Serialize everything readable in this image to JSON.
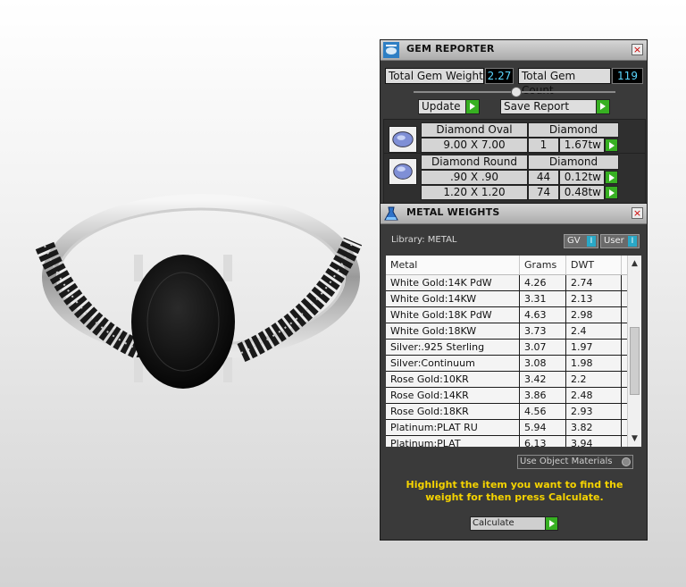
{
  "gem_reporter": {
    "title": "GEM REPORTER",
    "total_weight_label": "Total Gem Weight",
    "total_weight_value": "2.27",
    "total_count_label": "Total Gem Count",
    "total_count_value": "119",
    "update_label": "Update",
    "save_report_label": "Save Report",
    "gems": [
      {
        "name": "Diamond Oval",
        "material": "Diamond",
        "sizes": [
          {
            "size": "9.00 X 7.00",
            "count": "1",
            "weight": "1.67tw"
          }
        ]
      },
      {
        "name": "Diamond Round",
        "material": "Diamond",
        "sizes": [
          {
            "size": ".90 X .90",
            "count": "44",
            "weight": "0.12tw"
          },
          {
            "size": "1.20 X 1.20",
            "count": "74",
            "weight": "0.48tw"
          }
        ]
      }
    ]
  },
  "metal_weights": {
    "title": "METAL WEIGHTS",
    "library_label": "Library: METAL",
    "gv_label": "GV",
    "user_label": "User",
    "toggle_text": "I",
    "columns": [
      "Metal",
      "Grams",
      "DWT"
    ],
    "rows": [
      [
        "White Gold:14K PdW",
        "4.26",
        "2.74"
      ],
      [
        "White Gold:14KW",
        "3.31",
        "2.13"
      ],
      [
        "White Gold:18K PdW",
        "4.63",
        "2.98"
      ],
      [
        "White Gold:18KW",
        "3.73",
        "2.4"
      ],
      [
        "Silver:.925 Sterling",
        "3.07",
        "1.97"
      ],
      [
        "Silver:Continuum",
        "3.08",
        "1.98"
      ],
      [
        "Rose Gold:10KR",
        "3.42",
        "2.2"
      ],
      [
        "Rose Gold:14KR",
        "3.86",
        "2.48"
      ],
      [
        "Rose Gold:18KR",
        "4.56",
        "2.93"
      ],
      [
        "Platinum:PLAT RU",
        "5.94",
        "3.82"
      ],
      [
        "Platinum:PLAT",
        "6.13",
        "3.94"
      ]
    ],
    "use_object_materials": "Use Object Materials",
    "instruction": "Highlight the item you want to find the weight for then press Calculate.",
    "calculate_label": "Calculate"
  },
  "colors": {
    "panel_bg": "#3a3a3a",
    "value_text": "#5bd6ff",
    "go_green": "#37b022",
    "instruction_yellow": "#f5d300"
  }
}
